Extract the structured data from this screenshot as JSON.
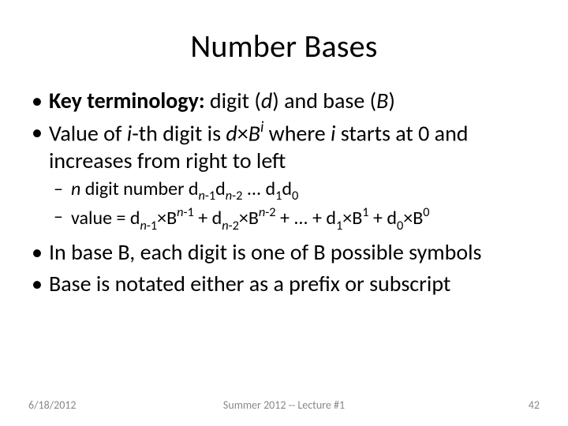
{
  "title": "Number Bases",
  "b1_lead": "Key terminology:",
  "b1_rest_a": "  digit (",
  "b1_d": "d",
  "b1_rest_b": ") and base (",
  "b1_B": "B",
  "b1_rest_c": ")",
  "b2_a": "Value of ",
  "b2_i1": "i",
  "b2_b": "-th digit is ",
  "b2_d": "d",
  "b2_mul": "×",
  "b2_B": "B",
  "b2_sup_i": "i",
  "b2_c": " where ",
  "b2_i2": "i",
  "b2_d2": " starts at 0 and increases from right to left",
  "s1_n": "n",
  "s1_a": " digit number d",
  "s1_n1": "n",
  "s1_m1": "-1",
  "s1_d2": "d",
  "s1_n2": "n",
  "s1_m2": "-2",
  "s1_dots": " ... d",
  "s1_one": "1",
  "s1_d0": "d",
  "s1_zero": "0",
  "s2_a": "value = d",
  "s2_n1": "n",
  "s2_m1": "-1",
  "s2_x1": "×",
  "s2_B1": "B",
  "s2_sn1": "n",
  "s2_sm1": "-1",
  "s2_p1": " + d",
  "s2_n2": "n",
  "s2_m2": "-2",
  "s2_x2": "×",
  "s2_B2": "B",
  "s2_sn2": "n",
  "s2_sm2": "-2",
  "s2_dots": " + ... + d",
  "s2_one": "1",
  "s2_x3": "×",
  "s2_B3": "B",
  "s2_s1": "1",
  "s2_p3": " + d",
  "s2_zero": "0",
  "s2_x4": "×",
  "s2_B4": "B",
  "s2_s0": "0",
  "b3": "In base B, each digit is one of B possible symbols",
  "b4": "Base is notated either as a prefix or subscript",
  "footer_date": "6/18/2012",
  "footer_center": "Summer 2012 -- Lecture #1",
  "footer_page": "42"
}
